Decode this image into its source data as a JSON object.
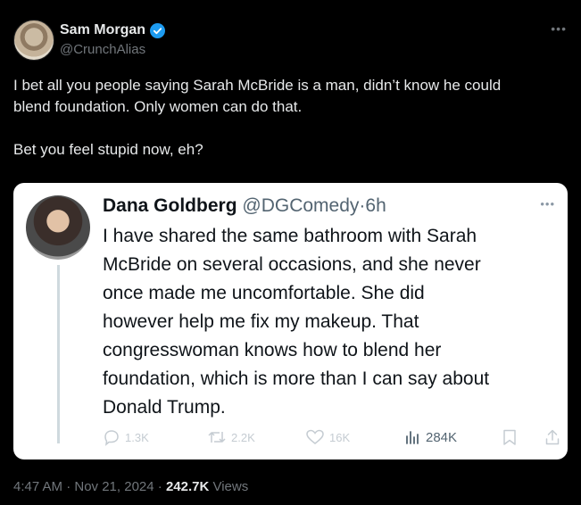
{
  "tweet": {
    "author": {
      "name": "Sam Morgan",
      "handle": "@CrunchAlias",
      "verified": true,
      "avatar_icon": "avatar"
    },
    "more_icon": "more-horizontal-icon",
    "text": "I bet all you people saying Sarah McBride is a man, didn’t know he could\nblend foundation. Only women can do that.\n\nBet you feel stupid now, eh?",
    "timestamp": "4:47 AM · Nov 21, 2024 · ",
    "views_count": "242.7K",
    "views_label": " Views"
  },
  "quote": {
    "name": "Dana Goldberg",
    "handle": "@DGComedy",
    "separator": "·",
    "time": "6h",
    "text": "I have shared the same bathroom with Sarah\nMcBride on several occasions, and she never\nonce made me uncomfortable. She did\nhowever help me fix my makeup. That\ncongresswoman knows how to blend her\nfoundation, which is more than I can say about\nDonald Trump.",
    "actions": {
      "reply": "1.3K",
      "retweet": "2.2K",
      "like": "16K",
      "views": "284K"
    }
  },
  "colors": {
    "verified": "#1d9bf0",
    "background": "#000000",
    "card": "#ffffff"
  }
}
